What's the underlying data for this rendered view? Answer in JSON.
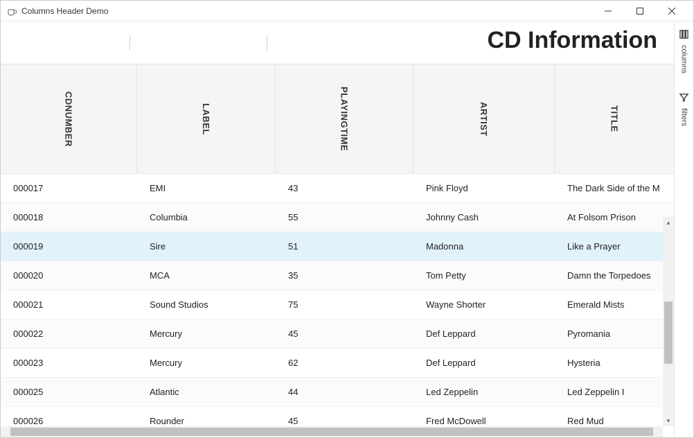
{
  "window": {
    "title": "Columns Header Demo"
  },
  "page": {
    "title": "CD Information"
  },
  "sidetabs": {
    "columns": "columns",
    "filters": "filters"
  },
  "columns": {
    "cdnumber": "CDNUMBER",
    "label": "LABEL",
    "playingtime": "PLAYINGTIME",
    "artist": "ARTIST",
    "title": "TITLE"
  },
  "rows": [
    {
      "cdnumber": "000017",
      "label": "EMI",
      "playingtime": "43",
      "artist": "Pink Floyd",
      "title": "The Dark Side of the M",
      "selected": false
    },
    {
      "cdnumber": "000018",
      "label": "Columbia",
      "playingtime": "55",
      "artist": "Johnny Cash",
      "title": "At Folsom Prison",
      "selected": false
    },
    {
      "cdnumber": "000019",
      "label": "Sire",
      "playingtime": "51",
      "artist": "Madonna",
      "title": "Like a Prayer",
      "selected": true
    },
    {
      "cdnumber": "000020",
      "label": "MCA",
      "playingtime": "35",
      "artist": "Tom Petty",
      "title": "Damn the Torpedoes",
      "selected": false
    },
    {
      "cdnumber": "000021",
      "label": "Sound Studios",
      "playingtime": "75",
      "artist": "Wayne Shorter",
      "title": "Emerald Mists",
      "selected": false
    },
    {
      "cdnumber": "000022",
      "label": "Mercury",
      "playingtime": "45",
      "artist": "Def Leppard",
      "title": "Pyromania",
      "selected": false
    },
    {
      "cdnumber": "000023",
      "label": "Mercury",
      "playingtime": "62",
      "artist": "Def Leppard",
      "title": "Hysteria",
      "selected": false
    },
    {
      "cdnumber": "000025",
      "label": "Atlantic",
      "playingtime": "44",
      "artist": "Led Zeppelin",
      "title": "Led Zeppelin I",
      "selected": false
    },
    {
      "cdnumber": "000026",
      "label": "Rounder",
      "playingtime": "45",
      "artist": "Fred McDowell",
      "title": "Red Mud",
      "selected": false
    }
  ]
}
